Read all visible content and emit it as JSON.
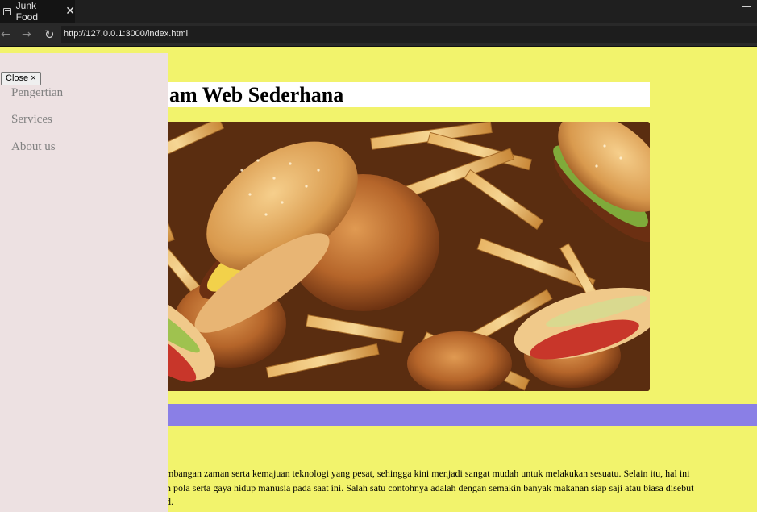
{
  "browser": {
    "tab_title": "Junk Food",
    "tab_close": "✕",
    "url": "http://127.0.0.1:3000/index.html",
    "back_glyph": "←",
    "forward_glyph": "→",
    "reload_glyph": "↻"
  },
  "page": {
    "title": "am Web Sederhana",
    "paragraph_lines": [
      "mbangan zaman serta kemajuan teknologi yang pesat, sehingga kini menjadi sangat mudah untuk melakukan sesuatu. Selain itu, hal ini",
      "n pola serta gaya hidup manusia pada saat ini. Salah satu contohnya adalah dengan semakin banyak makanan siap saji atau biasa disebut",
      "d."
    ],
    "colors": {
      "background": "#f2f36c",
      "band": "#8a7fe6",
      "sidebar": "#ede1e2"
    }
  },
  "sidebar": {
    "close_label": "Close ×",
    "items": [
      "Pengertian",
      "Services",
      "About us"
    ]
  }
}
